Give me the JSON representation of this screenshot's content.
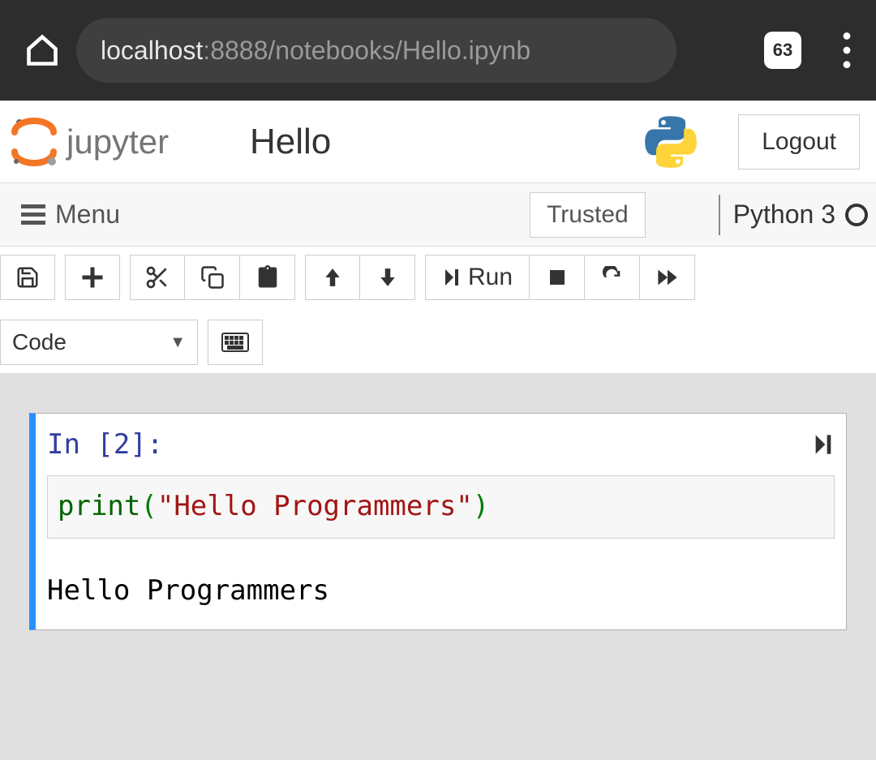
{
  "browser": {
    "url_host": "localhost",
    "url_path": ":8888/notebooks/Hello.ipynb",
    "tab_count": "63"
  },
  "header": {
    "notebook_title": "Hello",
    "logout_label": "Logout"
  },
  "menubar": {
    "menu_label": "Menu",
    "trusted_label": "Trusted",
    "kernel_label": "Python 3"
  },
  "toolbar": {
    "run_label": "Run",
    "cell_type": "Code"
  },
  "cell": {
    "prompt": "In [2]:",
    "code_fn": "print",
    "code_open": "(",
    "code_str": "\"Hello Programmers\"",
    "code_close": ")",
    "output": "Hello Programmers"
  }
}
